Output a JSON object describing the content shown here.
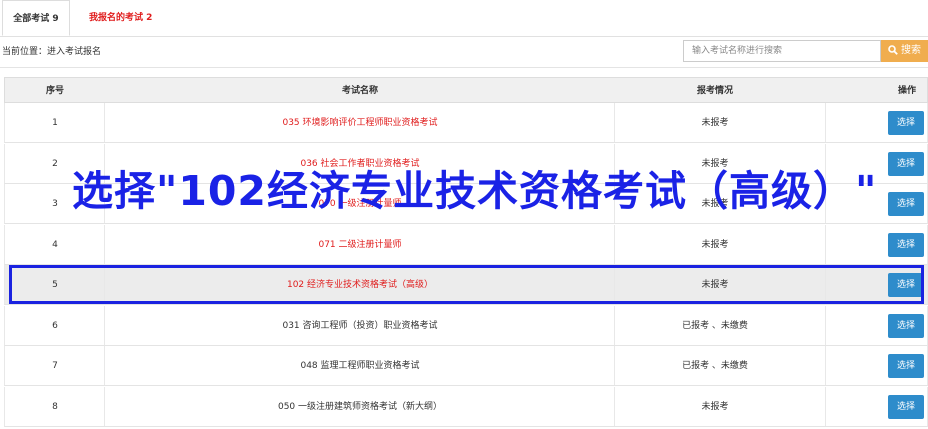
{
  "tabs": [
    {
      "label": "全部考试 9"
    },
    {
      "label": "我报名的考试 2"
    }
  ],
  "breadcrumb": "当前位置：进入考试报名",
  "search": {
    "placeholder": "输入考试名称进行搜索",
    "button_label": "搜索"
  },
  "table": {
    "headers": {
      "index": "序号",
      "name": "考试名称",
      "status": "报考情况",
      "action": "操作"
    },
    "rows": [
      {
        "index": "1",
        "name": "035 环境影响评价工程师职业资格考试",
        "status": "未报考",
        "action": "选择",
        "name_color": "#e01c1c"
      },
      {
        "index": "2",
        "name": "036 社会工作者职业资格考试",
        "status": "未报考",
        "action": "选择",
        "name_color": "#e01c1c"
      },
      {
        "index": "3",
        "name": "070 一级注册计量师",
        "status": "未报考",
        "action": "选择",
        "name_color": "#e01c1c"
      },
      {
        "index": "4",
        "name": "071 二级注册计量师",
        "status": "未报考",
        "action": "选择",
        "name_color": "#e01c1c"
      },
      {
        "index": "5",
        "name": "102 经济专业技术资格考试（高级）",
        "status": "未报考",
        "action": "选择",
        "name_color": "#e01c1c"
      },
      {
        "index": "6",
        "name": "031 咨询工程师（投资）职业资格考试",
        "status": "已报考 、未缴费",
        "action": "选择",
        "name_color": "#333333"
      },
      {
        "index": "7",
        "name": "048 监理工程师职业资格考试",
        "status": "已报考 、未缴费",
        "action": "选择",
        "name_color": "#333333"
      },
      {
        "index": "8",
        "name": "050 一级注册建筑师资格考试（新大纲）",
        "status": "未报考",
        "action": "选择",
        "name_color": "#333333"
      }
    ]
  },
  "overlay_text": "选择\"102经济专业技术资格考试（高级）\"",
  "colors": {
    "accent_red": "#e01c1c",
    "button_blue": "#2e8ccb",
    "search_orange": "#f0ad4e",
    "highlight_blue": "#1a22e0"
  }
}
